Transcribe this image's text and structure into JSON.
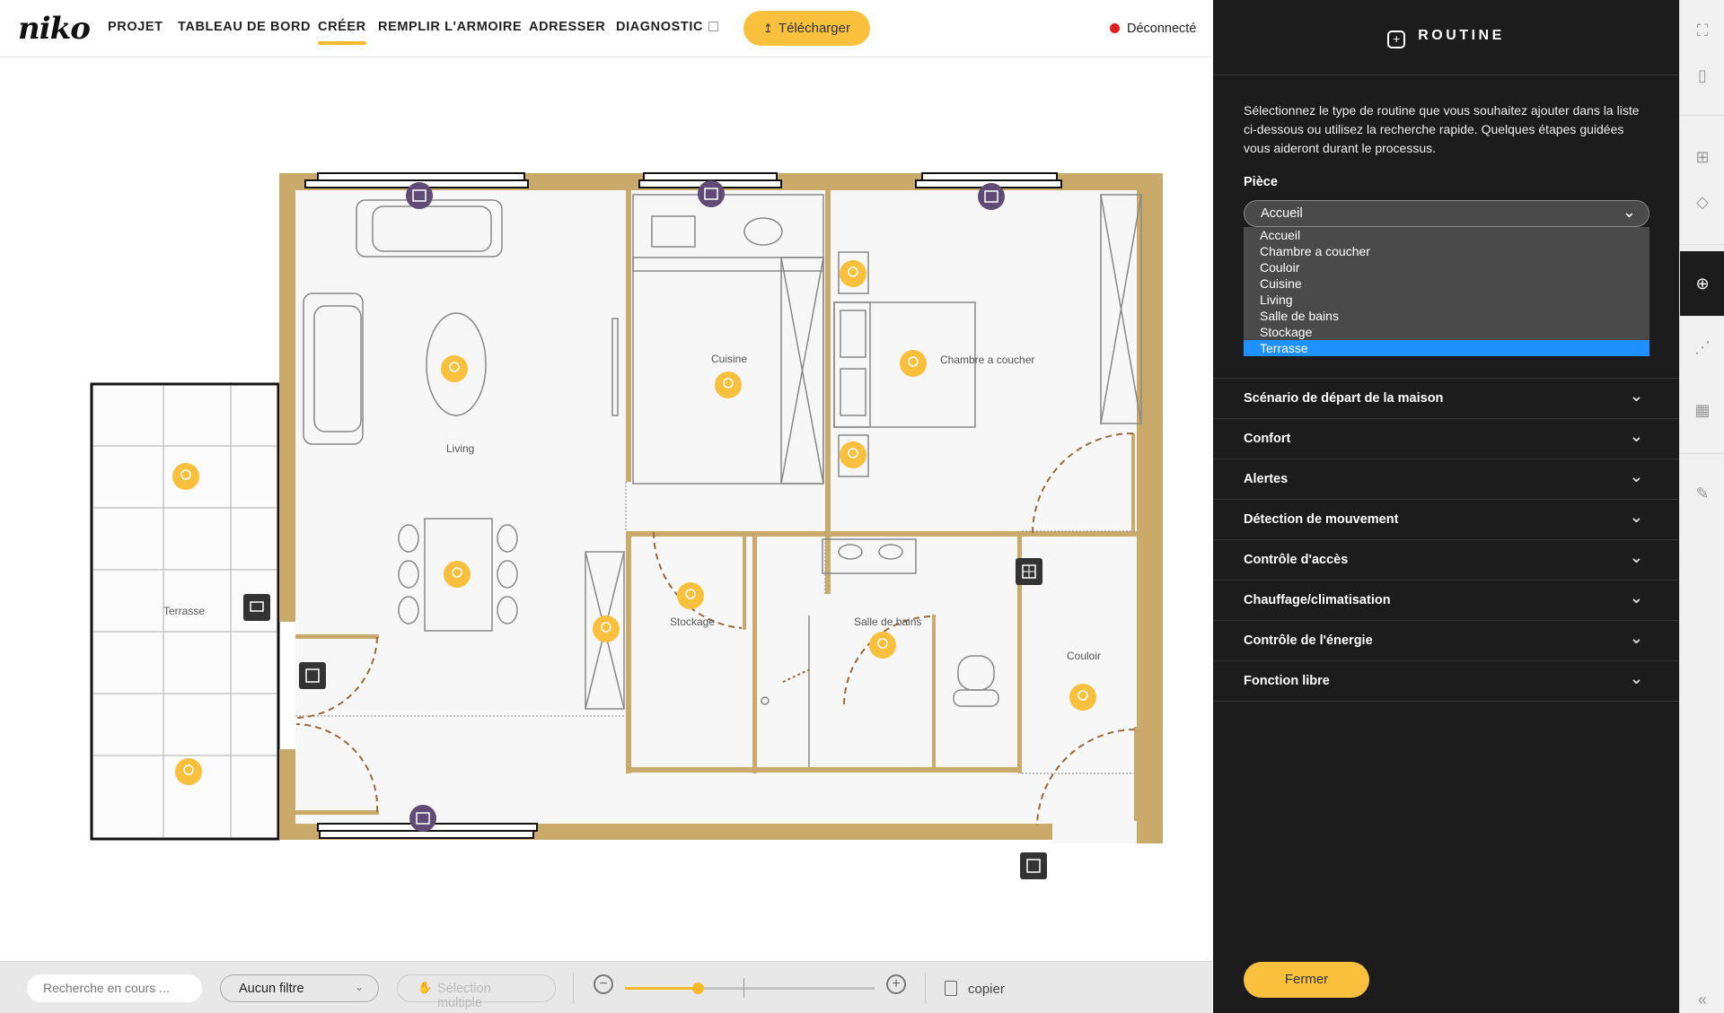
{
  "brand": {
    "logo": "niko"
  },
  "nav": {
    "items": [
      {
        "label": "PROJET"
      },
      {
        "label": "TABLEAU DE BORD"
      },
      {
        "label": "CRÉER"
      },
      {
        "label": "REMPLIR L'ARMOIRE"
      },
      {
        "label": "ADRESSER"
      },
      {
        "label": "DIAGNOSTIC"
      }
    ],
    "active": "CRÉER",
    "download_label": "Télécharger",
    "status_label": "Déconnecté",
    "status_color": "#e02020"
  },
  "floorplan": {
    "rooms": [
      {
        "label": "Living"
      },
      {
        "label": "Cuisine"
      },
      {
        "label": "Chambre a coucher"
      },
      {
        "label": "Terrasse"
      },
      {
        "label": "Stockage"
      },
      {
        "label": "Salle de bains"
      },
      {
        "label": "Couloir"
      }
    ],
    "wall_color": "#c9aa6a",
    "light_color": "#f9c03d",
    "shutter_color": "#5f4b75"
  },
  "bottombar": {
    "search_placeholder": "Recherche en cours ...",
    "filter_label": "Aucun filtre",
    "multi_label": "Sélection multiple",
    "copy_label": "copier",
    "zoom_level": 0.29
  },
  "panel": {
    "title": "ROUTINE",
    "description": "Sélectionnez le type de routine que vous souhaitez ajouter dans la liste ci-dessous ou utilisez la recherche rapide. Quelques étapes guidées vous aideront durant le processus.",
    "piece_label": "Pièce",
    "piece_value": "Accueil",
    "piece_options": [
      "Accueil",
      "Chambre a coucher",
      "Couloir",
      "Cuisine",
      "Living",
      "Salle de bains",
      "Stockage",
      "Terrasse"
    ],
    "piece_highlighted": "Terrasse",
    "sections": [
      {
        "label": "Scénario de départ de la maison"
      },
      {
        "label": "Confort"
      },
      {
        "label": "Alertes"
      },
      {
        "label": "Détection de mouvement"
      },
      {
        "label": "Contrôle d'accès"
      },
      {
        "label": "Chauffage/climatisation"
      },
      {
        "label": "Contrôle de l'énergie"
      },
      {
        "label": "Fonction libre"
      }
    ],
    "close_label": "Fermer",
    "accent_color": "#f9c03d"
  },
  "rail": {
    "icons": [
      "fullscreen-icon",
      "map-icon",
      "add-box-icon",
      "add-shapes-icon",
      "routine-icon",
      "share-nodes-icon",
      "calendar-icon",
      "tools-icon",
      "collapse-icon"
    ]
  }
}
